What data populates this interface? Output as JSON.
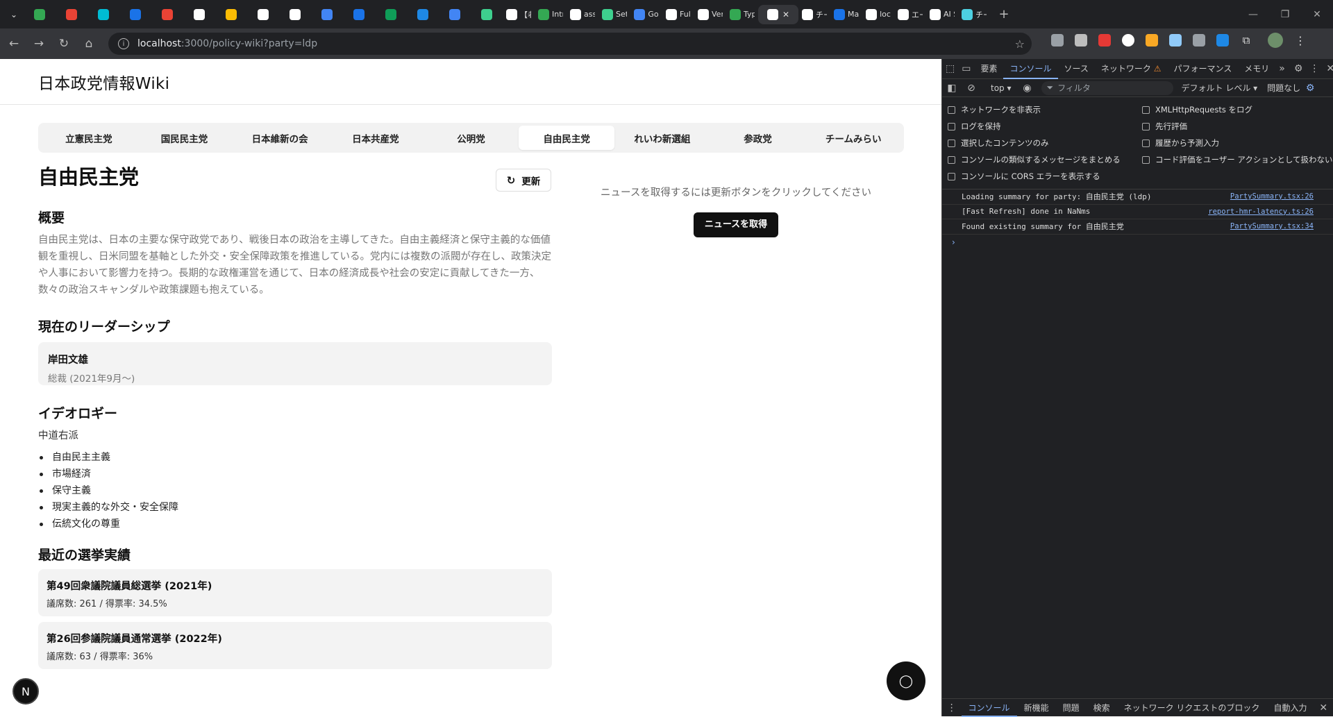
{
  "browser": {
    "tabs": [
      {
        "label": "",
        "color": "#34a853"
      },
      {
        "label": "",
        "color": "#ea4335"
      },
      {
        "label": "",
        "color": "#00bcd4"
      },
      {
        "label": "",
        "color": "#1a73e8"
      },
      {
        "label": "",
        "color": "#ea4335"
      },
      {
        "label": "",
        "color": "#ffffff"
      },
      {
        "label": "",
        "color": "#fbbc04"
      },
      {
        "label": "",
        "color": "#ffffff"
      },
      {
        "label": "",
        "color": "#ffffff"
      },
      {
        "label": "",
        "color": "#4285f4"
      },
      {
        "label": "",
        "color": "#1a73e8"
      },
      {
        "label": "",
        "color": "#0f9d58"
      },
      {
        "label": "",
        "color": "#1e88e5"
      },
      {
        "label": "",
        "color": "#4285f4"
      },
      {
        "label": "",
        "color": "#3ecf8e"
      },
      {
        "label": "【老",
        "color": "#ffffff"
      },
      {
        "label": "Intr",
        "color": "#34a853"
      },
      {
        "label": "ass",
        "color": "#ffffff"
      },
      {
        "label": "Set",
        "color": "#3ecf8e"
      },
      {
        "label": "Go",
        "color": "#4285f4"
      },
      {
        "label": "Full",
        "color": "#ffffff"
      },
      {
        "label": "Ver",
        "color": "#ffffff"
      },
      {
        "label": "Typ",
        "color": "#34a853"
      },
      {
        "label": "",
        "color": "#ffffff",
        "active": true
      },
      {
        "label": "チー",
        "color": "#ffffff"
      },
      {
        "label": "Ma",
        "color": "#1a73e8"
      },
      {
        "label": "loc",
        "color": "#ffffff"
      },
      {
        "label": "エー",
        "color": "#ffffff"
      },
      {
        "label": "AI S",
        "color": "#ffffff"
      },
      {
        "label": "チー",
        "color": "#4dd0e1"
      }
    ],
    "url_host": "localhost",
    "url_path": ":3000/policy-wiki?party=ldp"
  },
  "site": {
    "title": "日本政党情報Wiki"
  },
  "party_tabs": [
    {
      "label": "立憲民主党"
    },
    {
      "label": "国民民主党"
    },
    {
      "label": "日本維新の会"
    },
    {
      "label": "日本共産党"
    },
    {
      "label": "公明党"
    },
    {
      "label": "自由民主党",
      "active": true
    },
    {
      "label": "れいわ新選組"
    },
    {
      "label": "参政党"
    },
    {
      "label": "チームみらい"
    }
  ],
  "party": {
    "name": "自由民主党",
    "refresh_label": "更新",
    "overview_heading": "概要",
    "overview_text": "自由民主党は、日本の主要な保守政党であり、戦後日本の政治を主導してきた。自由主義経済と保守主義的な価値観を重視し、日米同盟を基軸とした外交・安全保障政策を推進している。党内には複数の派閥が存在し、政策決定や人事において影響力を持つ。長期的な政権運営を通じて、日本の経済成長や社会の安定に貢献してきた一方、数々の政治スキャンダルや政策課題も抱えている。",
    "leadership_heading": "現在のリーダーシップ",
    "leader_name": "岸田文雄",
    "leader_role": "総裁 (2021年9月〜)",
    "ideology_heading": "イデオロギー",
    "ideology_label": "中道右派",
    "ideology_items": [
      "自由民主主義",
      "市場経済",
      "保守主義",
      "現実主義的な外交・安全保障",
      "伝統文化の尊重"
    ],
    "elections_heading": "最近の選挙実績",
    "elections": [
      {
        "title": "第49回衆議院議員総選挙 (2021年)",
        "detail": "議席数: 261 / 得票率: 34.5%"
      },
      {
        "title": "第26回参議院議員通常選挙 (2022年)",
        "detail": "議席数: 63 / 得票率: 36%"
      }
    ]
  },
  "news": {
    "message": "ニュースを取得するには更新ボタンをクリックしてください",
    "button_label": "ニュースを取得"
  },
  "badge": {
    "letter": "N"
  },
  "devtools": {
    "tabs": [
      "要素",
      "コンソール",
      "ソース",
      "ネットワーク",
      "パフォーマンス",
      "メモリ"
    ],
    "context": "top ▾",
    "filter_placeholder": "フィルタ",
    "level": "デフォルト レベル ▾",
    "issues": "問題なし",
    "settings_left": [
      "ネットワークを非表示",
      "ログを保持",
      "選択したコンテンツのみ",
      "コンソールの類似するメッセージをまとめる",
      "コンソールに CORS エラーを表示する"
    ],
    "settings_right": [
      "XMLHttpRequests をログ",
      "先行評価",
      "履歴から予測入力",
      "コード評価をユーザー アクションとして扱わない"
    ],
    "logs": [
      {
        "text": "Loading summary for party: 自由民主党 (ldp)",
        "src": "PartySummary.tsx:26"
      },
      {
        "text": "[Fast Refresh] done in NaNms",
        "src": "report-hmr-latency.ts:26"
      },
      {
        "text": "Found existing summary for 自由民主党",
        "src": "PartySummary.tsx:34"
      }
    ],
    "bottom_tabs": [
      "コンソール",
      "新機能",
      "問題",
      "検索",
      "ネットワーク リクエストのブロック",
      "自動入力"
    ]
  }
}
